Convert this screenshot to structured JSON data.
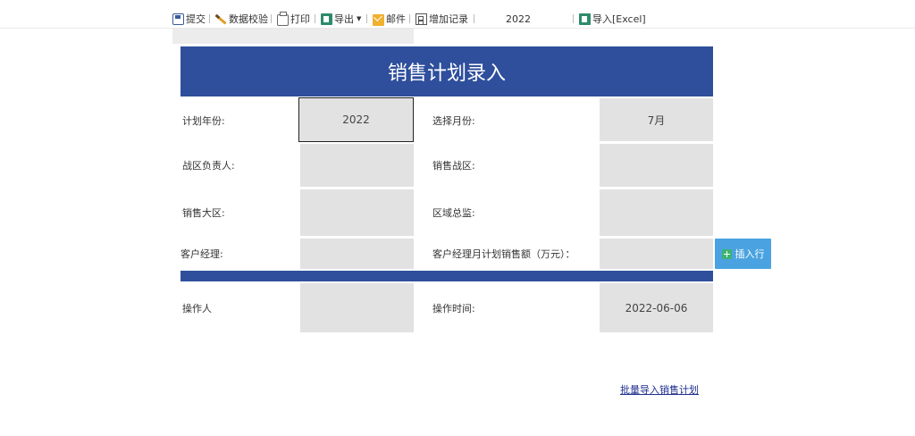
{
  "toolbar": {
    "submit": "提交",
    "validate": "数据校验",
    "print": "打印",
    "export": "导出",
    "mail": "邮件",
    "add_record": "增加记录",
    "year": "2022",
    "import_excel": "导入[Excel]"
  },
  "form": {
    "title": "销售计划录入",
    "plan_year_label": "计划年份:",
    "plan_year_value": "2022",
    "month_label": "选择月份:",
    "month_value": "7月",
    "zone_leader_label": "战区负责人:",
    "sales_zone_label": "销售战区:",
    "sales_region_label": "销售大区:",
    "region_director_label": "区域总监:",
    "account_manager_label": "客户经理:",
    "monthly_target_label": "客户经理月计划销售额（万元）：",
    "insert_row": "插入行",
    "operator_label": "操作人",
    "operate_time_label": "操作时间:",
    "operate_time_value": "2022-06-06"
  },
  "links": {
    "batch_import": "批量导入销售计划"
  },
  "icons": [
    "save-icon",
    "check-icon",
    "print-icon",
    "export-icon",
    "mail-icon",
    "add-record-icon",
    "excel-import-icon",
    "plus-icon"
  ],
  "colors": {
    "header": "#2f4f9c",
    "cell": "#e2e2e2",
    "button": "#4aa3e0",
    "link": "#1f2f8f"
  }
}
